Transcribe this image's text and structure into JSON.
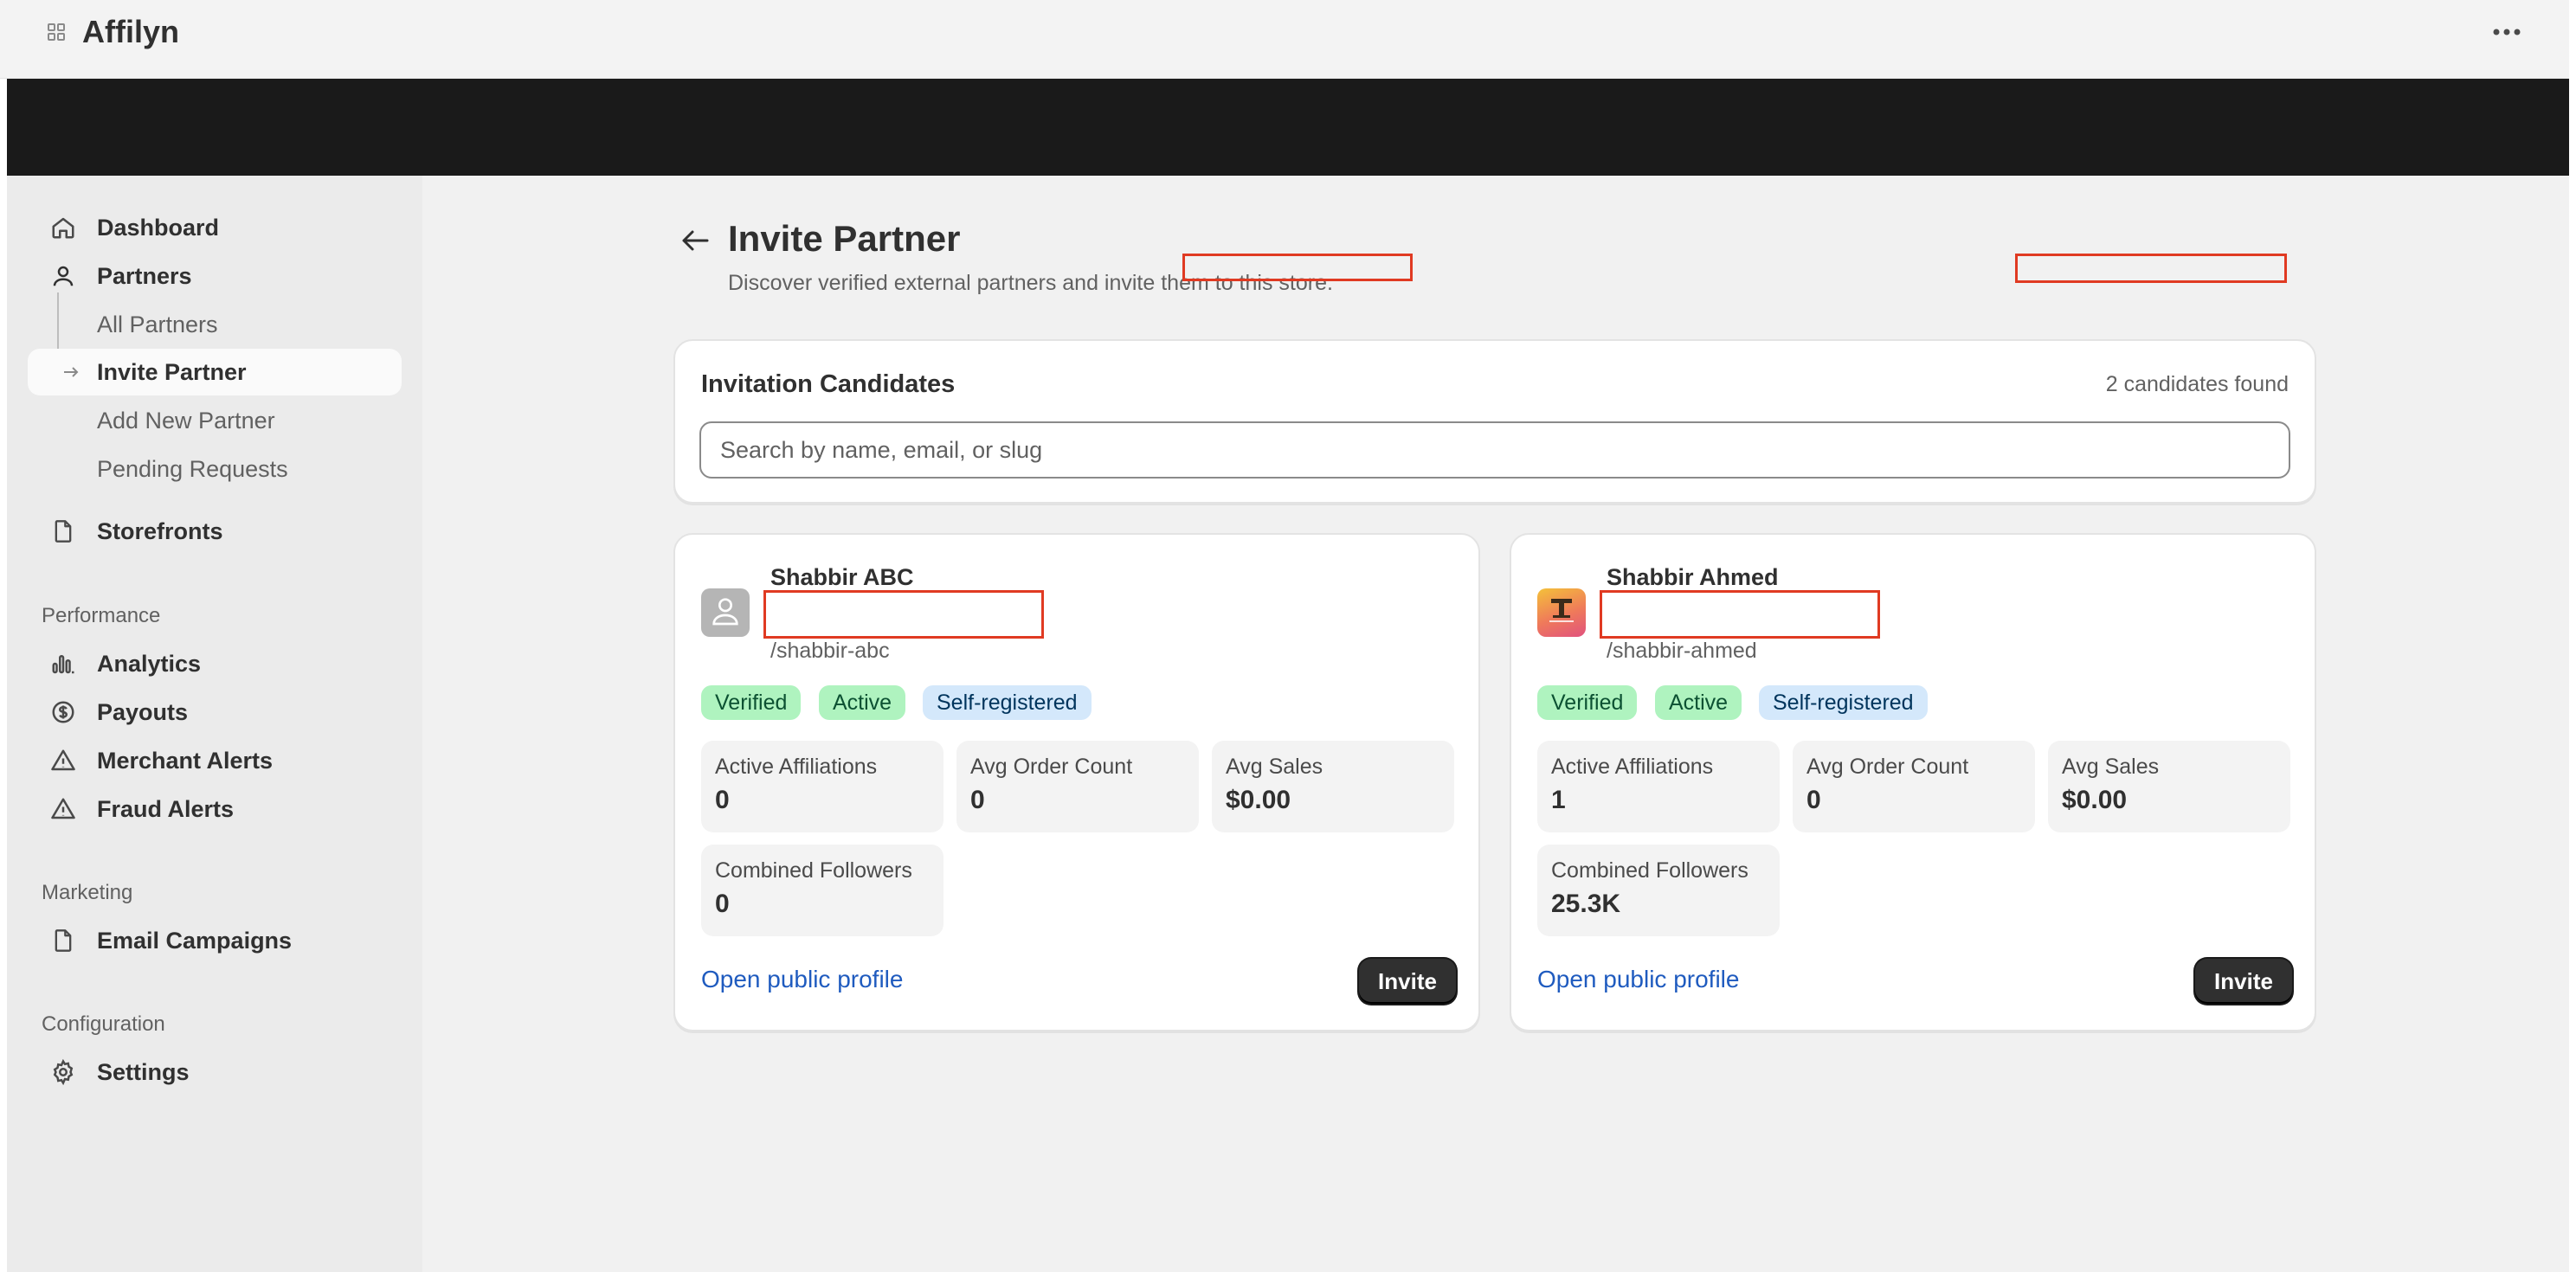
{
  "app": {
    "title": "Affilyn"
  },
  "sidebar": {
    "items": [
      {
        "label": "Dashboard",
        "icon": "home-icon"
      },
      {
        "label": "Partners",
        "icon": "person-icon"
      },
      {
        "label": "Storefronts",
        "icon": "page-icon"
      }
    ],
    "partners_sub": [
      {
        "label": "All Partners"
      },
      {
        "label": "Invite Partner",
        "active": true
      },
      {
        "label": "Add New Partner"
      },
      {
        "label": "Pending Requests"
      }
    ],
    "sections": {
      "performance": {
        "label": "Performance",
        "items": [
          {
            "label": "Analytics",
            "icon": "bar-chart-icon"
          },
          {
            "label": "Payouts",
            "icon": "dollar-circle-icon"
          },
          {
            "label": "Merchant Alerts",
            "icon": "alert-triangle-icon"
          },
          {
            "label": "Fraud Alerts",
            "icon": "alert-triangle-icon"
          }
        ]
      },
      "marketing": {
        "label": "Marketing",
        "items": [
          {
            "label": "Email Campaigns",
            "icon": "page-icon"
          }
        ]
      },
      "configuration": {
        "label": "Configuration",
        "items": [
          {
            "label": "Settings",
            "icon": "gear-icon"
          }
        ]
      }
    }
  },
  "page": {
    "title": "Invite Partner",
    "subtitle": "Discover verified external partners and invite them to this store."
  },
  "candidates": {
    "title": "Invitation Candidates",
    "count_text": "2 candidates found",
    "search_placeholder": "Search by name, email, or slug",
    "list": [
      {
        "name": "Shabbir ABC",
        "slug": "/shabbir-abc",
        "avatar": "person-placeholder",
        "badges": [
          "Verified",
          "Active",
          "Self-registered"
        ],
        "stats": {
          "active_affiliations_label": "Active Affiliations",
          "active_affiliations": "0",
          "avg_order_count_label": "Avg Order Count",
          "avg_order_count": "0",
          "avg_sales_label": "Avg Sales",
          "avg_sales": "$0.00",
          "combined_followers_label": "Combined Followers",
          "combined_followers": "0"
        },
        "profile_link": "Open public profile",
        "invite_label": "Invite"
      },
      {
        "name": "Shabbir Ahmed",
        "slug": "/shabbir-ahmed",
        "avatar": "brand-logo",
        "badges": [
          "Verified",
          "Active",
          "Self-registered"
        ],
        "stats": {
          "active_affiliations_label": "Active Affiliations",
          "active_affiliations": "1",
          "avg_order_count_label": "Avg Order Count",
          "avg_order_count": "0",
          "avg_sales_label": "Avg Sales",
          "avg_sales": "$0.00",
          "combined_followers_label": "Combined Followers",
          "combined_followers": "25.3K"
        },
        "profile_link": "Open public profile",
        "invite_label": "Invite"
      }
    ]
  },
  "colors": {
    "accent_link": "#1f5bbf",
    "badge_green": "#aff3bf",
    "badge_blue": "#d4e8fb",
    "redaction": "#e03a22",
    "button_dark": "#303030"
  }
}
